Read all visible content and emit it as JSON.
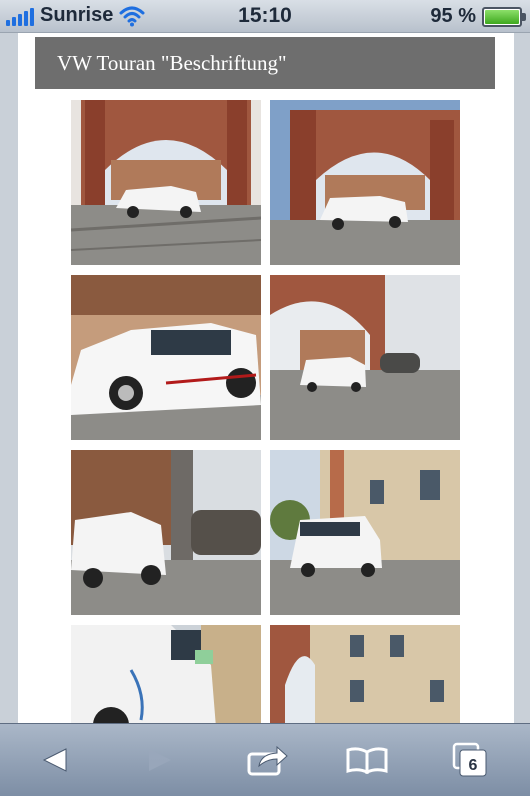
{
  "status_bar": {
    "carrier": "Sunrise",
    "time": "15:10",
    "battery_percent": "95 %",
    "battery_level": 0.95,
    "signal_bars": 5,
    "wifi_icon": "wifi-icon"
  },
  "page": {
    "title": "VW Touran \"Beschriftung\"",
    "gallery_items": 8
  },
  "toolbar": {
    "back_icon": "back-arrow-icon",
    "forward_icon": "forward-arrow-icon",
    "share_icon": "share-icon",
    "bookmarks_icon": "bookmarks-icon",
    "tabs_icon": "tabs-icon",
    "tabs_count": "6"
  }
}
